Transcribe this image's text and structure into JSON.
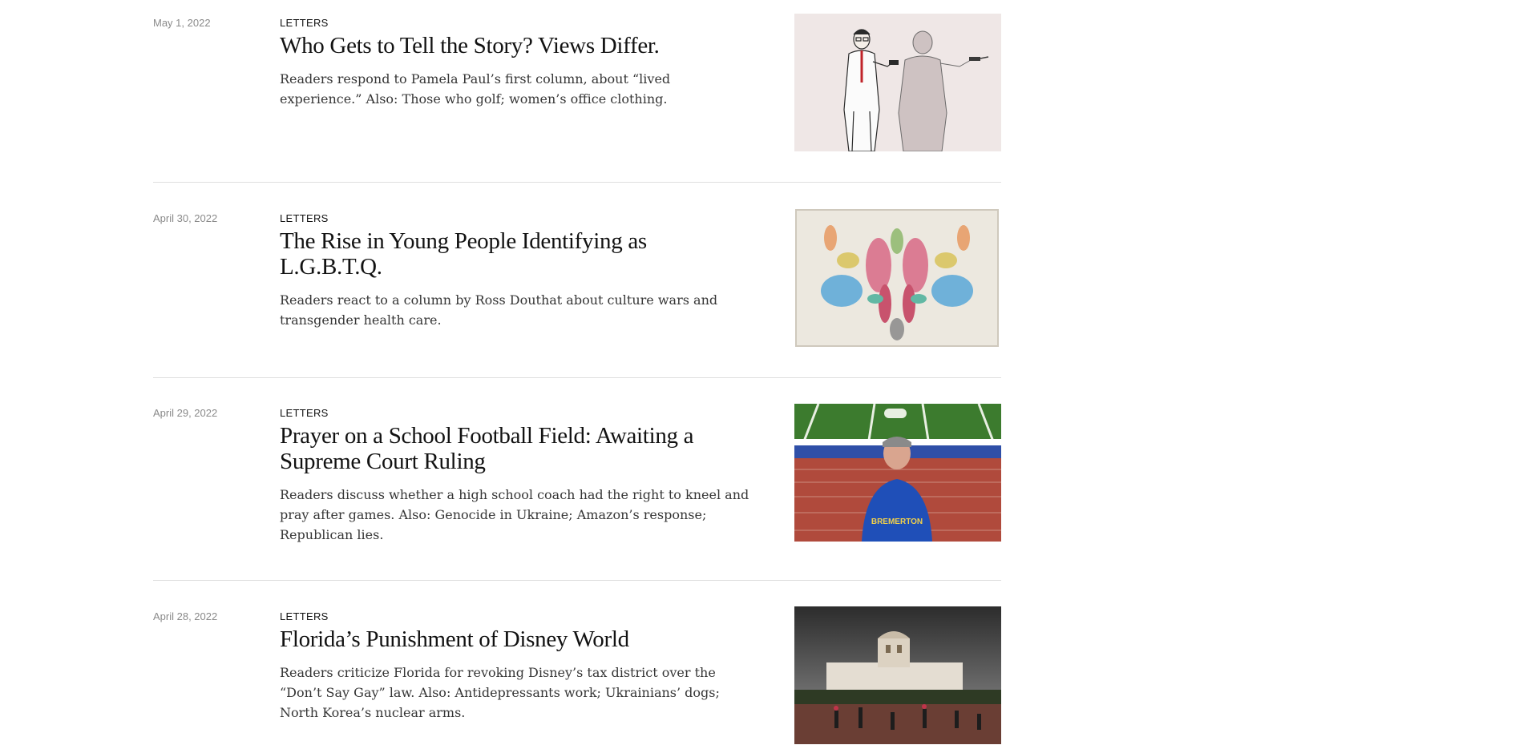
{
  "articles": [
    {
      "date": "May 1, 2022",
      "kicker": "LETTERS",
      "headline": "Who Gets to Tell the Story? Views Differ.",
      "summary": "Readers respond to Pamela Paul’s first column, about “lived experience.” Also: Those who golf; women’s office clothing.",
      "image": "illustration-two-scientists"
    },
    {
      "date": "April 30, 2022",
      "kicker": "LETTERS",
      "headline": "The Rise in Young People Identifying as L.G.B.T.Q.",
      "summary": "Readers react to a column by Ross Douthat about culture wars and transgender health care.",
      "image": "watercolor-inkblot"
    },
    {
      "date": "April 29, 2022",
      "kicker": "LETTERS",
      "headline": "Prayer on a School Football Field: Awaiting a Supreme Court Ruling",
      "summary": "Readers discuss whether a high school coach had the right to kneel and pray after games. Also: Genocide in Ukraine; Amazon’s response; Republican lies.",
      "image": "coach-on-football-field",
      "image_text": "BREMERTON"
    },
    {
      "date": "April 28, 2022",
      "kicker": "LETTERS",
      "headline": "Florida’s Punishment of Disney World",
      "summary": "Readers criticize Florida for revoking Disney’s tax district over the “Don’t Say Gay” law. Also: Antidepressants work; Ukrainians’ dogs; North Korea’s nuclear arms.",
      "image": "disney-world-entrance-stormy-sky"
    }
  ]
}
